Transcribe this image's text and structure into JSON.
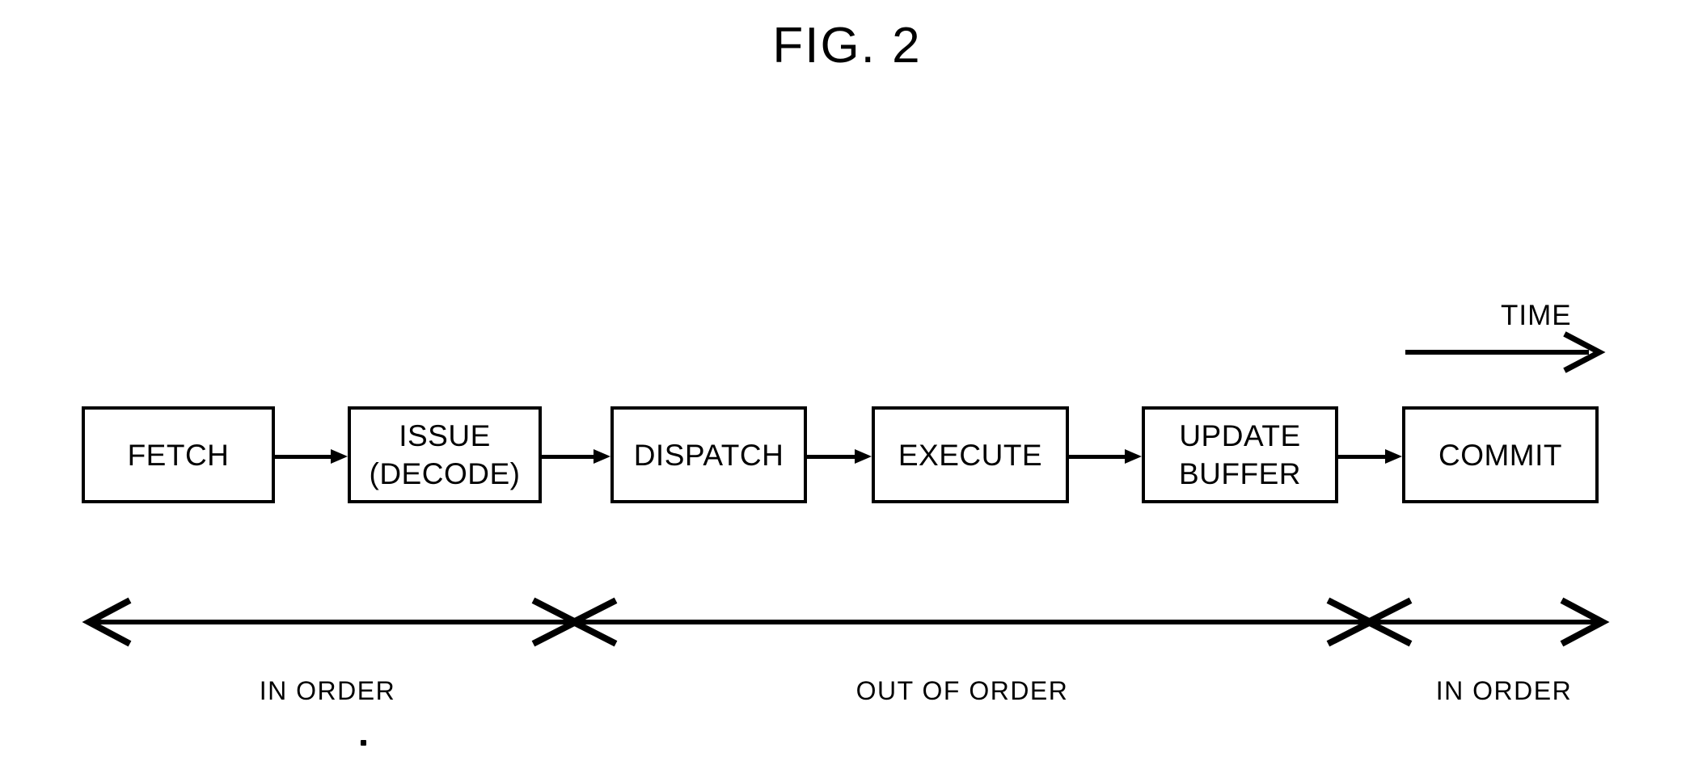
{
  "figure": {
    "title": "FIG. 2",
    "ink_color": "#000000",
    "background_color": "#ffffff"
  },
  "time_axis": {
    "label": "TIME",
    "direction": "left-to-right"
  },
  "pipeline": {
    "stages": [
      {
        "id": "fetch",
        "lines": [
          "FETCH"
        ]
      },
      {
        "id": "issue",
        "lines": [
          "ISSUE",
          "(DECODE)"
        ]
      },
      {
        "id": "dispatch",
        "lines": [
          "DISPATCH"
        ]
      },
      {
        "id": "execute",
        "lines": [
          "EXECUTE"
        ]
      },
      {
        "id": "update-buffer",
        "lines": [
          "UPDATE",
          "BUFFER"
        ]
      },
      {
        "id": "commit",
        "lines": [
          "COMMIT"
        ]
      }
    ]
  },
  "phase_axis": {
    "segments": [
      {
        "id": "in-order-front",
        "label": "IN ORDER"
      },
      {
        "id": "out-of-order",
        "label": "OUT OF ORDER"
      },
      {
        "id": "in-order-back",
        "label": "IN ORDER"
      }
    ]
  }
}
